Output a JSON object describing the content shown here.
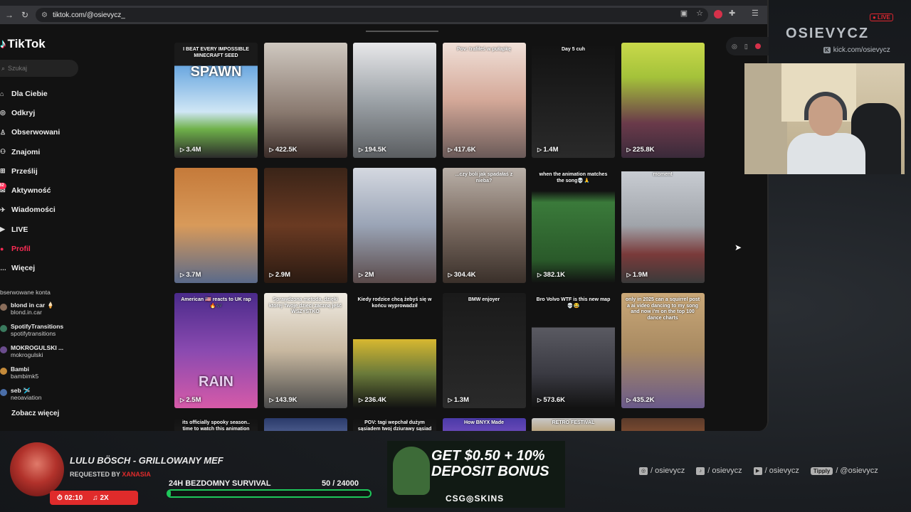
{
  "browser": {
    "url": "tiktok.com/@osievycz_"
  },
  "tiktok": {
    "logo": "TikTok",
    "search_placeholder": "Szukaj",
    "nav": [
      {
        "label": "Dla Ciebie",
        "icon": "home-icon"
      },
      {
        "label": "Odkryj",
        "icon": "compass-icon"
      },
      {
        "label": "Obserwowani",
        "icon": "following-icon"
      },
      {
        "label": "Znajomi",
        "icon": "friends-icon"
      },
      {
        "label": "Prześlij",
        "icon": "upload-icon"
      },
      {
        "label": "Aktywność",
        "icon": "activity-icon",
        "badge": "62"
      },
      {
        "label": "Wiadomości",
        "icon": "messages-icon"
      },
      {
        "label": "LIVE",
        "icon": "live-icon"
      },
      {
        "label": "Profil",
        "icon": "profile-icon",
        "active": true
      },
      {
        "label": "Więcej",
        "icon": "more-icon"
      }
    ],
    "followed_title": "bserwowane konta",
    "followed": [
      {
        "name": "blond in car 🍦",
        "handle": "blond.in.car"
      },
      {
        "name": "SpotifyTransitions",
        "handle": "spotifytransitions"
      },
      {
        "name": "MOKROGULSKI ...",
        "handle": "mokrogulski"
      },
      {
        "name": "Bambi",
        "handle": "bambimk5"
      },
      {
        "name": "seb 🛩️",
        "handle": "neoaviation"
      }
    ],
    "see_more": "Zobacz więcej",
    "videos": [
      {
        "views": "3.4M",
        "caption": "I BEAT EVERY IMPOSSIBLE MINECRAFT SEED",
        "overlay": "SPAWN"
      },
      {
        "views": "422.5K",
        "caption": ""
      },
      {
        "views": "194.5K",
        "caption": ""
      },
      {
        "views": "417.6K",
        "caption": "Pov: trafiłeś w pułapkę"
      },
      {
        "views": "1.4M",
        "caption": "Day 5 cuh"
      },
      {
        "views": "225.8K",
        "caption": ""
      },
      {
        "views": "3.7M",
        "caption": ""
      },
      {
        "views": "2.9M",
        "caption": ""
      },
      {
        "views": "2M",
        "caption": ""
      },
      {
        "views": "304.4K",
        "caption": "...czy boli jak spadałaś z nieba?"
      },
      {
        "views": "382.1K",
        "caption": "when the animation matches the song💀🙏"
      },
      {
        "views": "1.9M",
        "caption": "moment"
      },
      {
        "views": "2.5M",
        "caption": "American 🇺🇸 reacts to UK rap 🔥🎶",
        "overlay": "RAIN"
      },
      {
        "views": "143.9K",
        "caption": "Sprawdzona metoda, dzięki której Twoje dzieci zaczną jeść WSZYSTKO"
      },
      {
        "views": "236.4K",
        "caption": "Kiedy rodzice chcą żebyś się w końcu wyprowadził"
      },
      {
        "views": "1.3M",
        "caption": "BMW enjoyer"
      },
      {
        "views": "573.6K",
        "caption": "Bro Volvo WTF is this new map 💀😂"
      },
      {
        "views": "435.2K",
        "caption": "only in 2025 can a squirrel post a ai video dancing to my song and now i'm on the top 100 dance charts"
      },
      {
        "views": "",
        "caption": "its officially spooky season.. time to watch this animation"
      },
      {
        "views": "",
        "caption": ""
      },
      {
        "views": "",
        "caption": "POV: tagi wepchał dużym sąsiadem twoj dziurawy sąsiad"
      },
      {
        "views": "",
        "caption": "How BNYX Made"
      },
      {
        "views": "",
        "caption": "RETRO FESTIVAL"
      },
      {
        "views": "",
        "caption": ""
      }
    ]
  },
  "stream": {
    "brand": "OSIEVYCZ",
    "live_badge": "● LIVE",
    "kick_url": "kick.com/osievycz",
    "song_title": "LULU BÖSCH - GRILLOWANY MEF",
    "requested_by_label": "REQUESTED BY",
    "requested_by": "XANASIA",
    "song_time": "02:10",
    "song_count": "2X",
    "goal_title": "24H BEZDOMNY SURVIVAL",
    "goal_count": "50  / 24000",
    "goal_progress": 0.0021,
    "ad_text_1": "GET $0.50 + 10%",
    "ad_text_2": "DEPOSIT BONUS",
    "ad_brand": "CSG◎SKINS",
    "socials": [
      {
        "icon": "instagram-icon",
        "text": "/ osievycz"
      },
      {
        "icon": "tiktok-icon",
        "text": "/ osievycz"
      },
      {
        "icon": "youtube-icon",
        "text": "/ osievycz"
      },
      {
        "icon": "tipply-icon",
        "label": "Tipply",
        "text": "/ @osievycz"
      }
    ]
  },
  "colors": {
    "accent": "#fe2c55",
    "goal_green": "#1ec75a",
    "stream_red": "#e02b2b"
  }
}
